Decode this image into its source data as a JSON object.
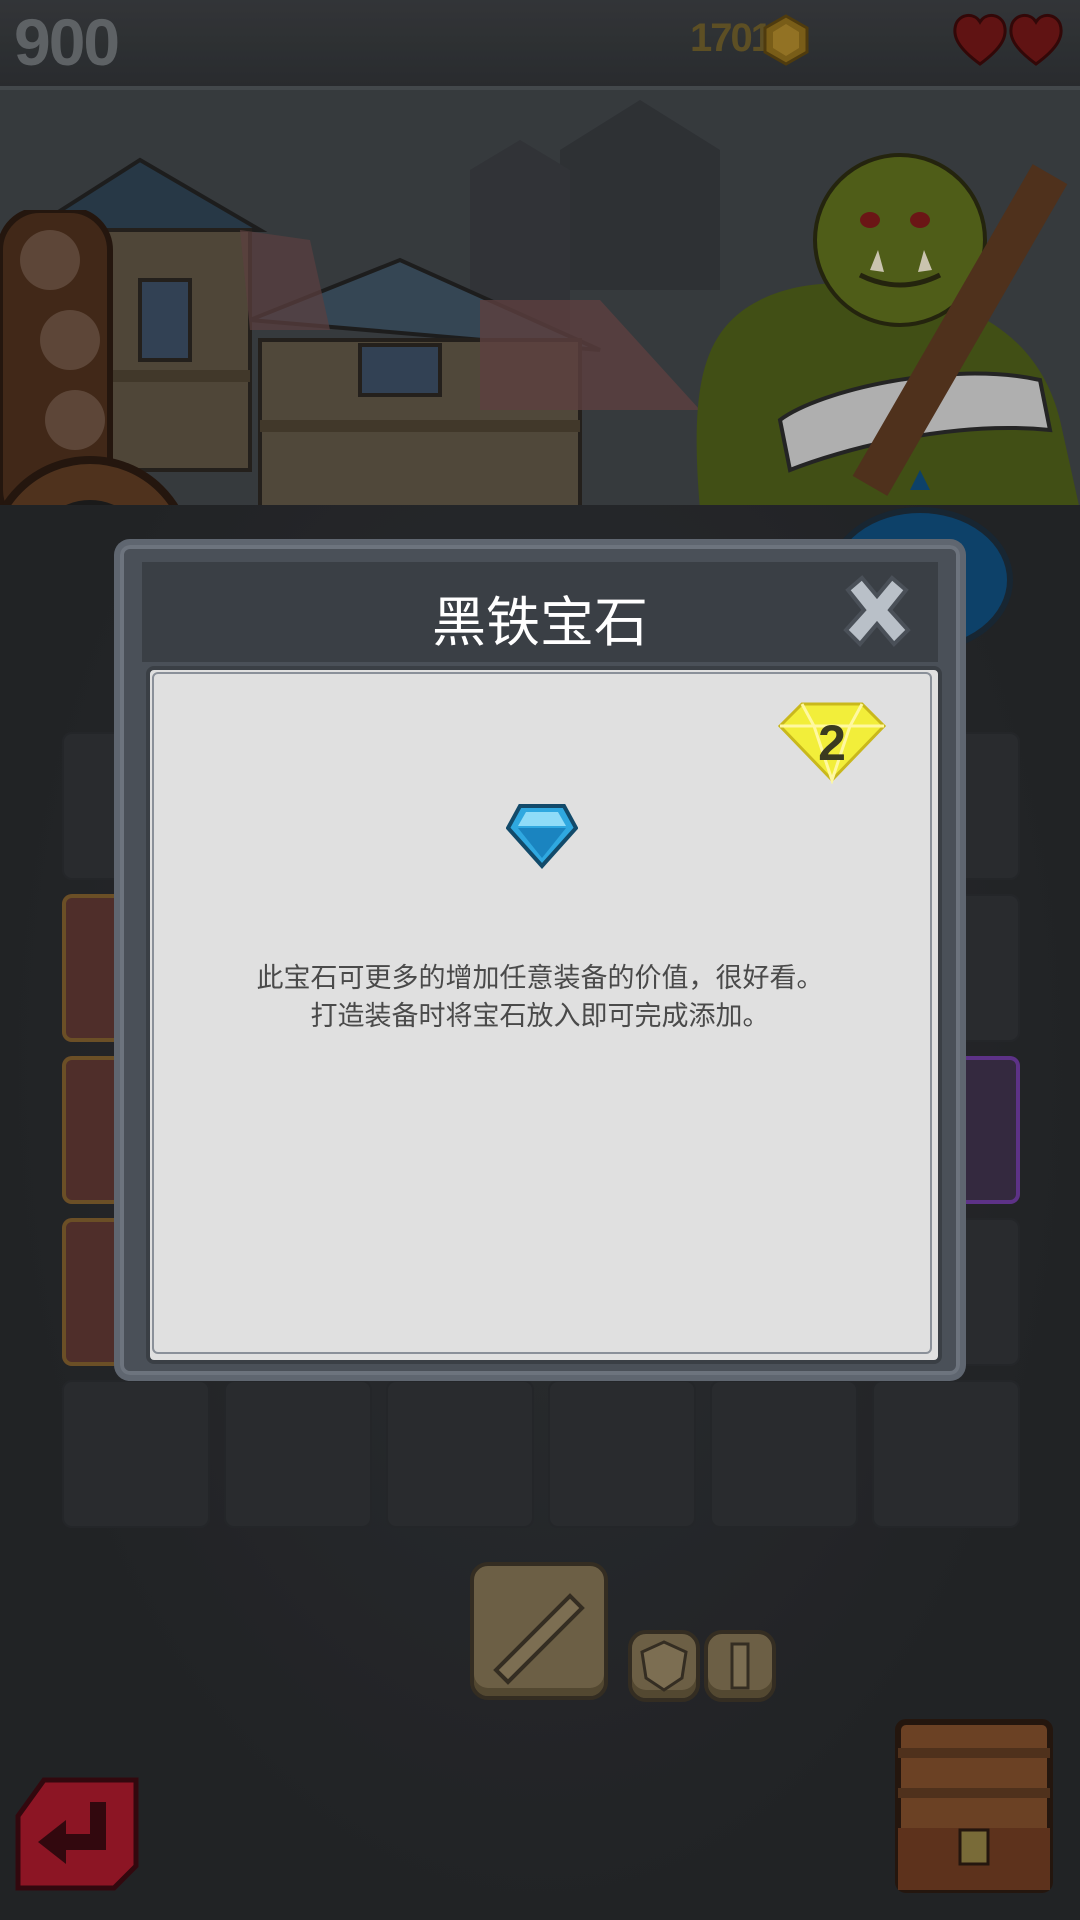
{
  "hud": {
    "score": "900",
    "coins": "1701",
    "lives": 2,
    "coin_icon": "gold-hexagon-coin-icon",
    "heart_icon": "heart-icon"
  },
  "modal": {
    "title": "黑铁宝石",
    "level": "2",
    "description_line1": "此宝石可更多的增加任意装备的价值，很好看。",
    "description_line2": "打造装备时将宝石放入即可完成添加。",
    "gem_icon": "blue-gem-icon",
    "close_icon": "close-x-icon"
  },
  "colors": {
    "modal_body": "#e0e0e0",
    "modal_frame": "#4a5058",
    "gem_blue": "#2fa8e0",
    "level_badge_yellow": "#f2ee3a",
    "heart_red": "#7a1a1a"
  }
}
